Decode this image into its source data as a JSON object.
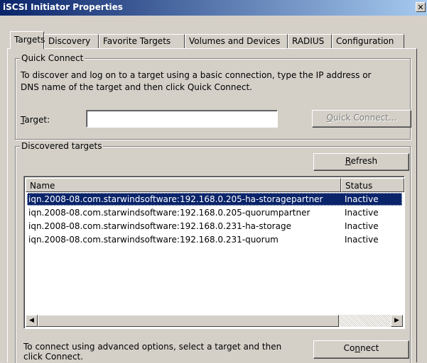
{
  "window": {
    "title": "iSCSI Initiator Properties",
    "close": "✕"
  },
  "tabs": [
    {
      "label": "Targets"
    },
    {
      "label": "Discovery"
    },
    {
      "label": "Favorite Targets"
    },
    {
      "label": "Volumes and Devices"
    },
    {
      "label": "RADIUS"
    },
    {
      "label": "Configuration"
    }
  ],
  "quick_connect": {
    "group_title": "Quick Connect",
    "description_line1": "To discover and log on to a target using a basic connection, type the IP address or",
    "description_line2": "DNS name of the target and then click Quick Connect.",
    "target_label_first": "T",
    "target_label_rest": "arget:",
    "target_value": "",
    "button_first": "Q",
    "button_rest": "uick Connect..."
  },
  "discovered": {
    "group_title": "Discovered targets",
    "refresh_first": "R",
    "refresh_rest": "efresh",
    "columns": {
      "name": "Name",
      "status": "Status"
    },
    "rows": [
      {
        "name": "iqn.2008-08.com.starwindsoftware:192.168.0.205-ha-storagepartner",
        "status": "Inactive",
        "selected": true
      },
      {
        "name": "iqn.2008-08.com.starwindsoftware:192.168.0.205-quorumpartner",
        "status": "Inactive",
        "selected": false
      },
      {
        "name": "iqn.2008-08.com.starwindsoftware:192.168.0.231-ha-storage",
        "status": "Inactive",
        "selected": false
      },
      {
        "name": "iqn.2008-08.com.starwindsoftware:192.168.0.231-quorum",
        "status": "Inactive",
        "selected": false
      }
    ],
    "scroll_left": "◀",
    "scroll_right": "▶",
    "footer_line1": "To connect using advanced options, select a target and then",
    "footer_line2": "click Connect.",
    "connect_first": "Co",
    "connect_mid": "n",
    "connect_rest": "nect"
  }
}
